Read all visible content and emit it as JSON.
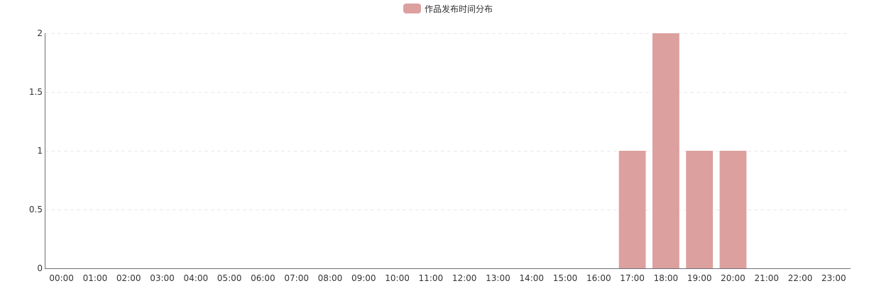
{
  "chart_data": {
    "type": "bar",
    "categories": [
      "00:00",
      "01:00",
      "02:00",
      "03:00",
      "04:00",
      "05:00",
      "06:00",
      "07:00",
      "08:00",
      "09:00",
      "10:00",
      "11:00",
      "12:00",
      "13:00",
      "14:00",
      "15:00",
      "16:00",
      "17:00",
      "18:00",
      "19:00",
      "20:00",
      "21:00",
      "22:00",
      "23:00"
    ],
    "series": [
      {
        "name": "作品发布时间分布",
        "values": [
          0,
          0,
          0,
          0,
          0,
          0,
          0,
          0,
          0,
          0,
          0,
          0,
          0,
          0,
          0,
          0,
          0,
          1,
          2,
          1,
          1,
          0,
          0,
          0
        ]
      }
    ],
    "yticks": [
      "0",
      "0.5",
      "1",
      "1.5",
      "2"
    ],
    "ylim": [
      0,
      2
    ],
    "grid": "horizontal-dashed",
    "legend": "top-center",
    "colors": {
      "bar": "#dca09e",
      "axis": "#6e7079",
      "grid": "#e8e8e8",
      "label": "#333333"
    }
  }
}
